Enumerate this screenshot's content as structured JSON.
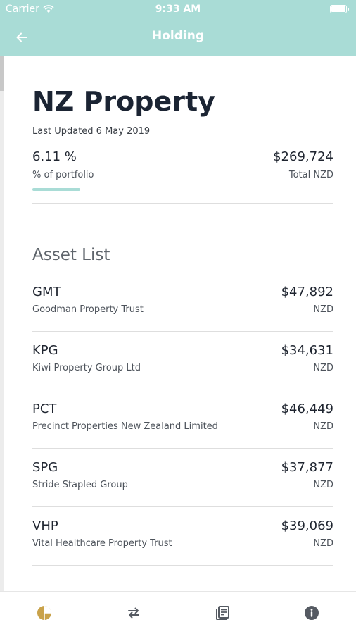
{
  "status_bar": {
    "carrier": "Carrier",
    "time": "9:33 AM"
  },
  "nav": {
    "title": "Holding",
    "back_icon": "back-arrow-icon"
  },
  "holding": {
    "title": "NZ Property",
    "last_updated": "Last Updated 6 May 2019",
    "percent": "6.11 %",
    "percent_label": "% of portfolio",
    "percent_fraction": 0.0611,
    "total": "$269,724",
    "total_label": "Total NZD"
  },
  "asset_list": {
    "heading": "Asset List",
    "items": [
      {
        "ticker": "GMT",
        "name": "Goodman Property Trust",
        "value": "$47,892",
        "currency": "NZD"
      },
      {
        "ticker": "KPG",
        "name": "Kiwi Property Group Ltd",
        "value": "$34,631",
        "currency": "NZD"
      },
      {
        "ticker": "PCT",
        "name": "Precinct Properties New Zealand Limited",
        "value": "$46,449",
        "currency": "NZD"
      },
      {
        "ticker": "SPG",
        "name": "Stride Stapled Group",
        "value": "$37,877",
        "currency": "NZD"
      },
      {
        "ticker": "VHP",
        "name": "Vital Healthcare Property Trust",
        "value": "$39,069",
        "currency": "NZD"
      }
    ]
  },
  "tabbar": {
    "tabs": [
      {
        "icon": "pie-chart-icon",
        "active": true
      },
      {
        "icon": "transfer-arrows-icon",
        "active": false
      },
      {
        "icon": "news-icon",
        "active": false
      },
      {
        "icon": "info-icon",
        "active": false
      }
    ]
  },
  "colors": {
    "accent": "#a9dcd6",
    "active_tab": "#c9a24a",
    "inactive_tab": "#555a62"
  }
}
